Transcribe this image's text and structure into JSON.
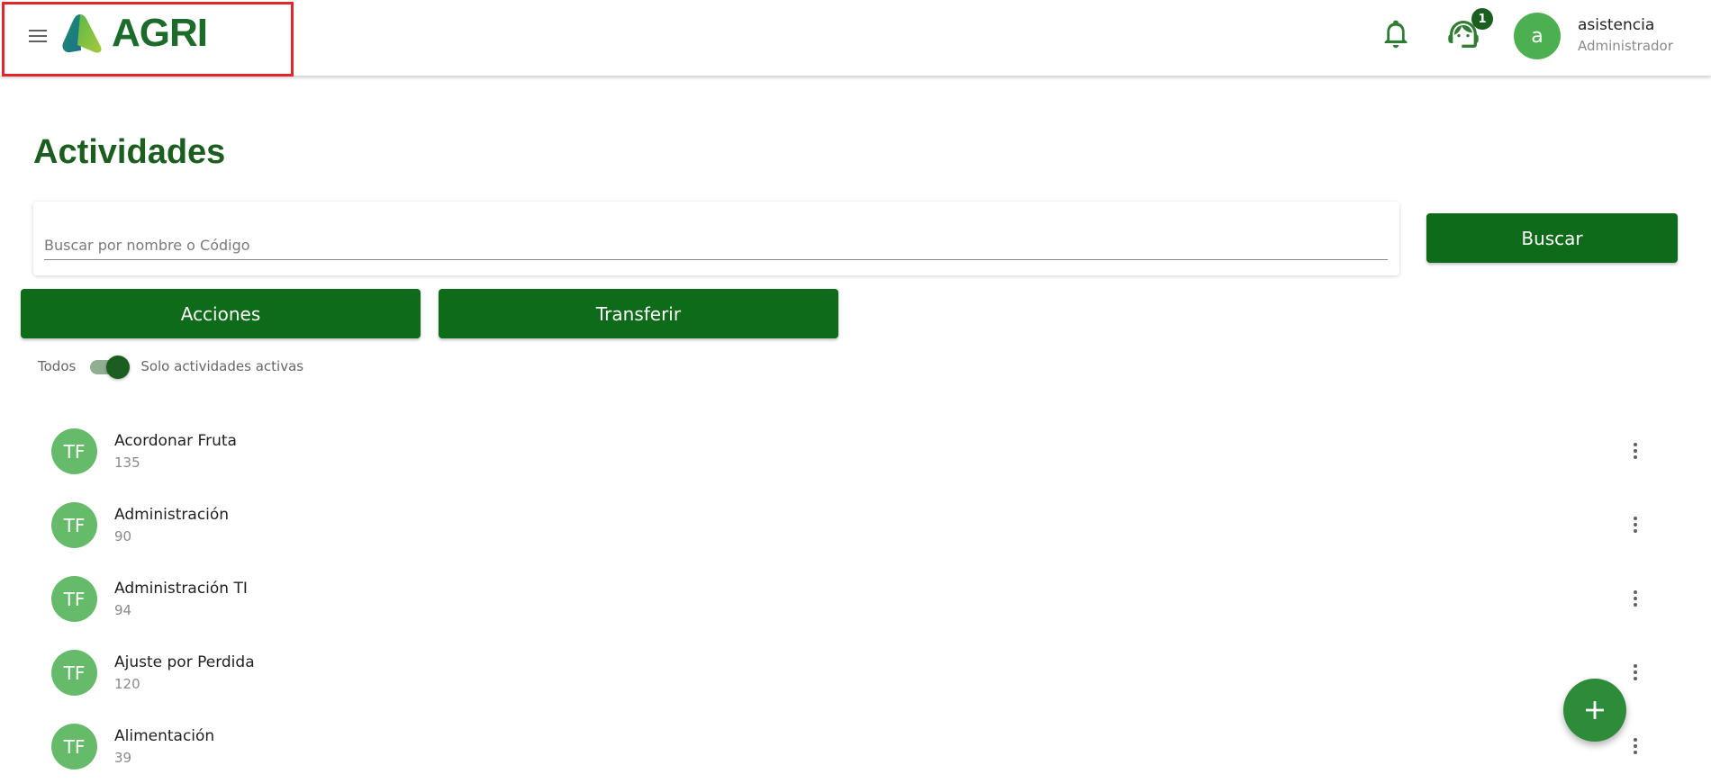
{
  "header": {
    "logo_text": "AGRI",
    "notification_count": "1",
    "user": {
      "avatar_letter": "a",
      "name": "asistencia",
      "role": "Administrador"
    }
  },
  "page": {
    "title": "Actividades"
  },
  "search": {
    "placeholder": "Buscar por nombre o Código",
    "value": "",
    "button_label": "Buscar"
  },
  "actions": {
    "acciones_label": "Acciones",
    "transferir_label": "Transferir"
  },
  "filter": {
    "left_label": "Todos",
    "right_label": "Solo actividades activas",
    "active_only": true
  },
  "activities": [
    {
      "initials": "TF",
      "name": "Acordonar Fruta",
      "code": "135"
    },
    {
      "initials": "TF",
      "name": "Administración",
      "code": "90"
    },
    {
      "initials": "TF",
      "name": "Administración TI",
      "code": "94"
    },
    {
      "initials": "TF",
      "name": "Ajuste por Perdida",
      "code": "120"
    },
    {
      "initials": "TF",
      "name": "Alimentación",
      "code": "39"
    }
  ],
  "colors": {
    "primary": "#0d6b1a",
    "title": "#1b5e20",
    "avatar": "#66bb6a",
    "highlight": "#e3262b"
  },
  "icons": [
    "menu-icon",
    "bell-icon",
    "support-agent-icon",
    "more-vert-icon",
    "plus-icon"
  ]
}
